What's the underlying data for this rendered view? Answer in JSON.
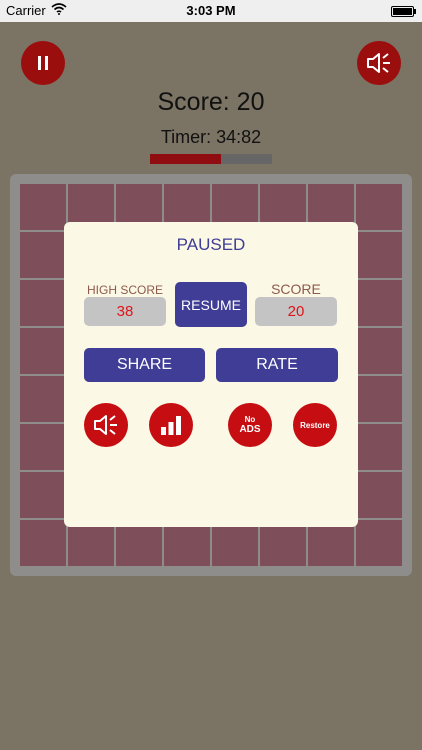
{
  "status_bar": {
    "carrier": "Carrier",
    "time": "3:03 PM",
    "battery_level": 1.0
  },
  "hud": {
    "score_text": "Score: 20",
    "timer_text": "Timer: 34:82",
    "timer_progress": 0.58
  },
  "board": {
    "rows": 8,
    "cols": 8
  },
  "pause_dialog": {
    "title": "PAUSED",
    "high_score_label": "HIGH SCORE",
    "high_score_value": "38",
    "resume_label": "RESUME",
    "score_label": "SCORE",
    "score_value": "20",
    "share_label": "SHARE",
    "rate_label": "RATE",
    "no_ads_line1": "No",
    "no_ads_line2": "ADS",
    "restore_label": "Restore"
  },
  "icons": {
    "pause": "pause-icon",
    "sound_off": "speaker-mute-icon",
    "leaderboard": "bar-chart-icon",
    "wifi": "wifi-icon",
    "battery": "battery-icon"
  },
  "colors": {
    "background": "#7b7464",
    "accent_red": "#9b0e0e",
    "button_red": "#c60d11",
    "primary_blue": "#3f3d95",
    "dialog_bg": "#fbf8e6",
    "tile": "#7e4f5b"
  }
}
